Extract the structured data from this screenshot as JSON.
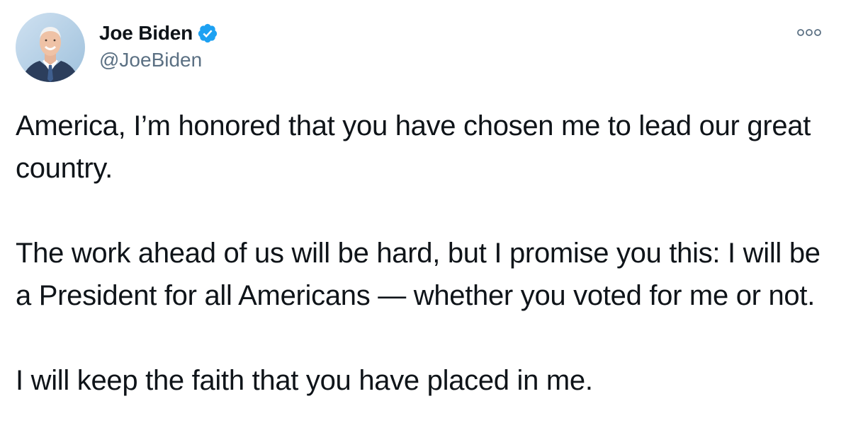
{
  "author": {
    "name": "Joe Biden",
    "handle": "@JoeBiden",
    "verified": true,
    "avatar_icon": "profile-photo-icon"
  },
  "more_icon": "more-options-icon",
  "tweet": {
    "text": "America, I’m honored that you have chosen me to lead our great country.\n\nThe work ahead of us will be hard, but I promise you this: I will be a President for all Americans — whether you voted for me or not.\n\nI will keep the faith that you have placed in me."
  },
  "colors": {
    "verified_badge": "#1da1f2",
    "handle_text": "#5b7083",
    "body_text": "#0f1419",
    "more_icon": "#5b7083"
  }
}
